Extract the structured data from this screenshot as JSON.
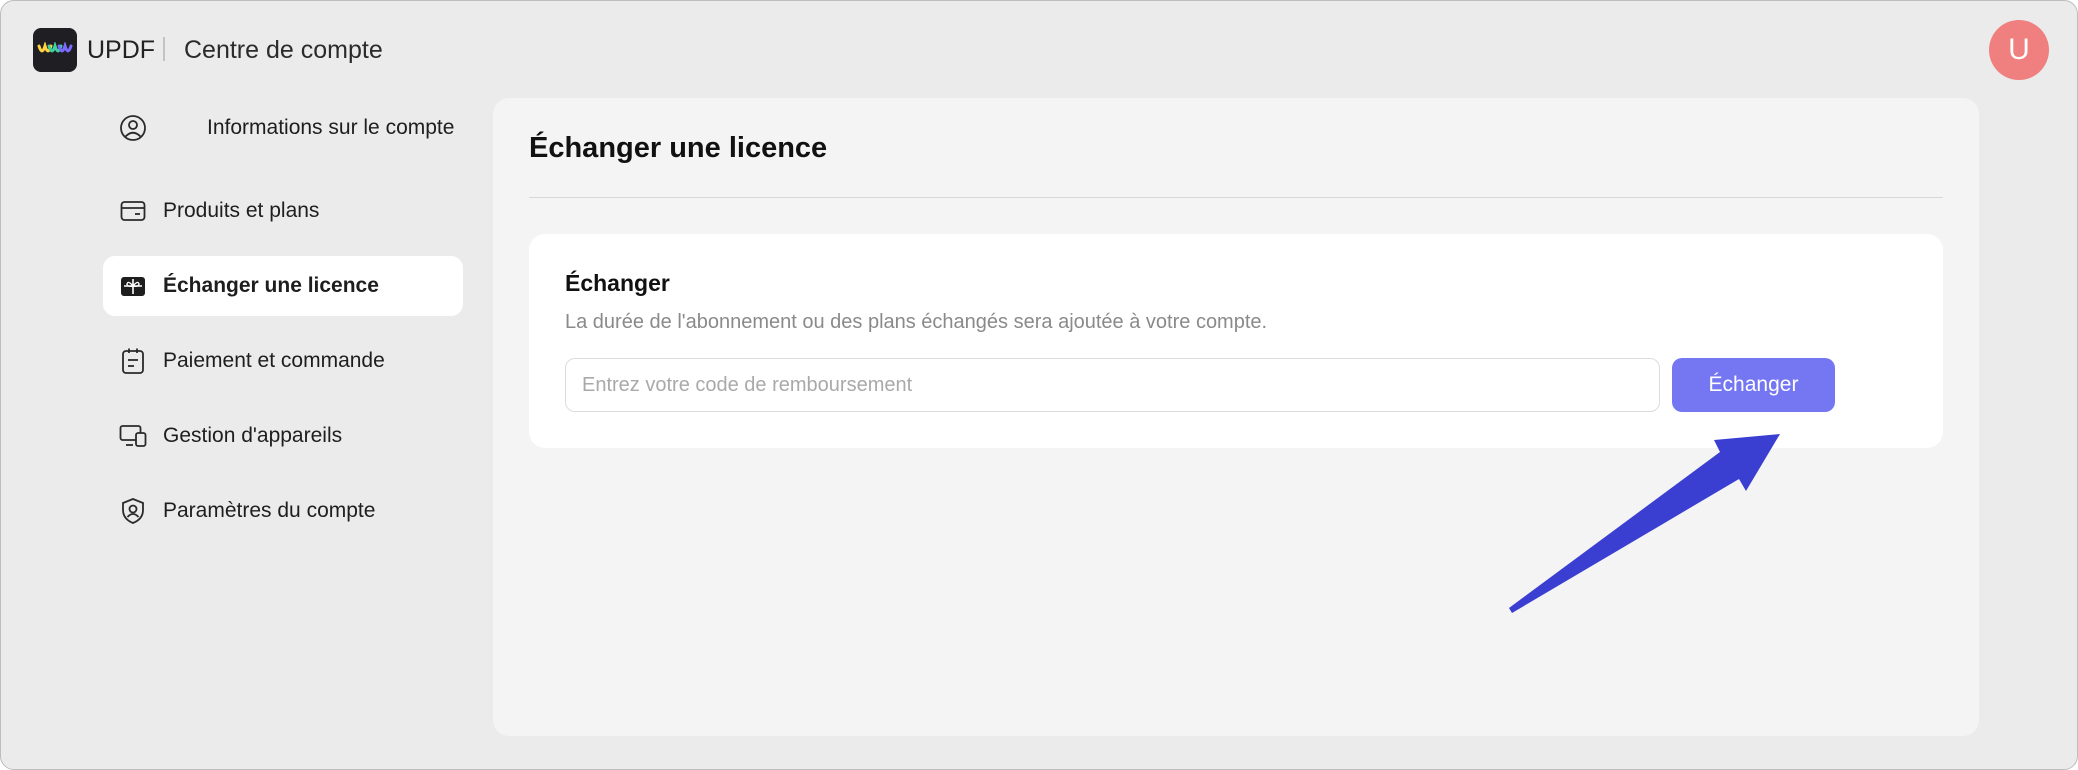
{
  "header": {
    "brand": "UPDF",
    "title": "Centre de compte",
    "avatar_initial": "U"
  },
  "sidebar": {
    "items": [
      {
        "label": "Informations sur le compte",
        "icon": "user-circle-icon",
        "active": false
      },
      {
        "label": "Produits et plans",
        "icon": "card-icon",
        "active": false
      },
      {
        "label": "Échanger une licence",
        "icon": "gift-icon",
        "active": true
      },
      {
        "label": "Paiement et commande",
        "icon": "clipboard-icon",
        "active": false
      },
      {
        "label": "Gestion d'appareils",
        "icon": "devices-icon",
        "active": false
      },
      {
        "label": "Paramètres du compte",
        "icon": "shield-user-icon",
        "active": false
      }
    ]
  },
  "main": {
    "title": "Échanger une licence",
    "card": {
      "title": "Échanger",
      "description": "La durée de l'abonnement ou des plans échangés sera ajoutée à votre compte.",
      "input_value": "",
      "input_placeholder": "Entrez votre code de remboursement",
      "button_label": "Échanger"
    }
  },
  "colors": {
    "accent": "#7476f2",
    "avatar": "#f07f7f",
    "arrow": "#3b3fd1",
    "background": "#ebebeb"
  }
}
